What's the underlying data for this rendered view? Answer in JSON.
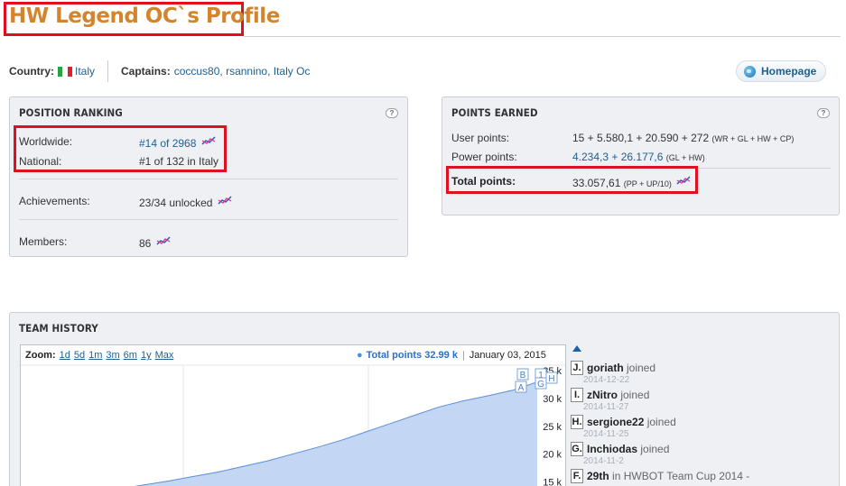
{
  "profile": {
    "title": "HW Legend OC`s Profile",
    "country_label": "Country:",
    "country": "Italy",
    "captains_label": "Captains:",
    "captains": "coccus80, rsannino, Italy Oc",
    "homepage_label": "Homepage"
  },
  "ranking": {
    "heading": "POSITION RANKING",
    "worldwide_label": "Worldwide:",
    "worldwide_value": "#14 of 2968",
    "national_label": "National:",
    "national_value": "#1 of 132 in Italy",
    "achievements_label": "Achievements:",
    "achievements_value": "23/34",
    "achievements_suffix": "unlocked",
    "members_label": "Members:",
    "members_value": "86"
  },
  "points": {
    "heading": "POINTS EARNED",
    "user_label": "User points:",
    "user_value": "15 + 5.580,1 + 20.590 + 272",
    "user_note": "(WR + GL + HW + CP)",
    "power_label": "Power points:",
    "power_value": "4.234,3 + 26.177,6",
    "power_note": "(GL + HW)",
    "total_label": "Total points:",
    "total_value": "33.057,61",
    "total_note": "(PP + UP/10)"
  },
  "history": {
    "heading": "TEAM HISTORY",
    "zoom_label": "Zoom:",
    "zoom_options": [
      "1d",
      "5d",
      "1m",
      "3m",
      "6m",
      "1y",
      "Max"
    ],
    "legend_series": "Total points",
    "legend_value": "32.99 k",
    "legend_date": "January 03, 2015",
    "flags": [
      "B",
      "1",
      "G",
      "A",
      "H"
    ],
    "events": [
      {
        "letter": "J.",
        "name": "goriath",
        "action": "joined",
        "date": "2014-12-22"
      },
      {
        "letter": "I.",
        "name": "zNitro",
        "action": "joined",
        "date": "2014-11-27"
      },
      {
        "letter": "H.",
        "name": "sergione22",
        "action": "joined",
        "date": "2014-11-25"
      },
      {
        "letter": "G.",
        "name": "Inchiodas",
        "action": "joined",
        "date": "2014-11-2"
      },
      {
        "letter": "F.",
        "name": "29th",
        "action": "in HWBOT Team Cup 2014 -",
        "date": ""
      }
    ]
  },
  "chart_data": {
    "type": "area",
    "title": "",
    "series": [
      {
        "name": "Total points",
        "values": [
          12.5,
          12.6,
          12.8,
          13.2,
          13.8,
          14.5,
          15.2,
          16.0,
          16.8,
          17.8,
          18.8,
          20.0,
          21.2,
          22.5,
          24.0,
          25.5,
          27.0,
          28.5,
          29.6,
          30.5,
          31.5,
          32.99
        ]
      }
    ],
    "y_ticks": [
      "15 k",
      "20 k",
      "25 k",
      "30 k",
      "35 k"
    ],
    "ylim": [
      12,
      36
    ],
    "colors": {
      "fill": "#c3d6f3",
      "line": "#5b8fd8"
    }
  }
}
